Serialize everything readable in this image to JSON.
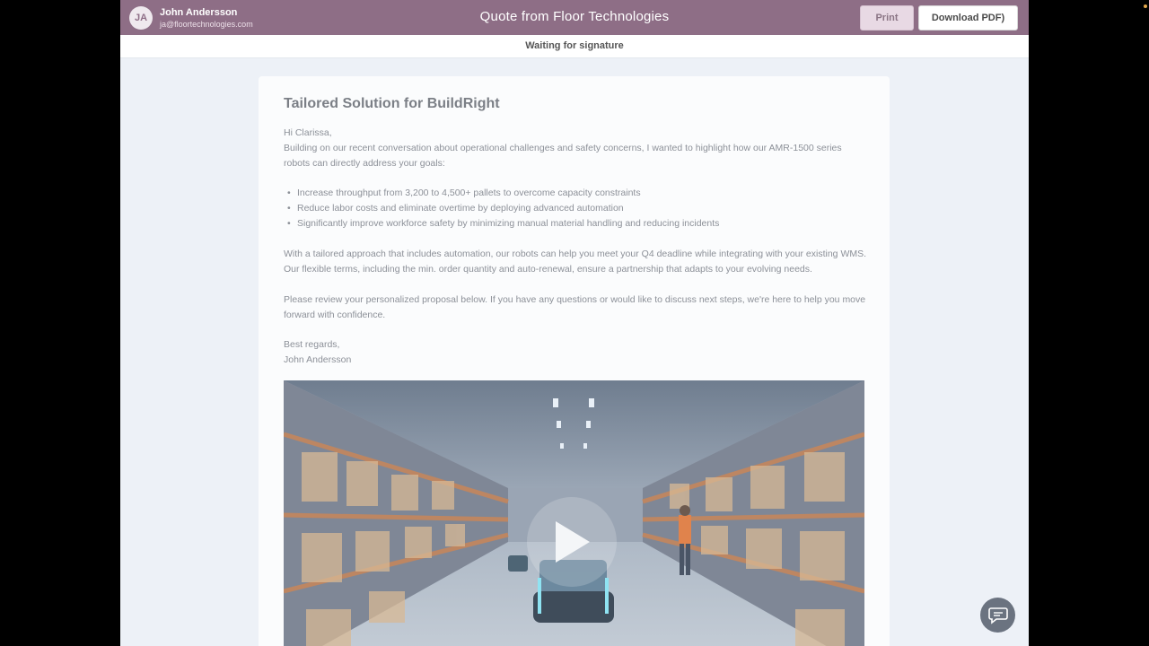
{
  "header": {
    "avatar_initials": "JA",
    "user_name": "John Andersson",
    "user_email": "ja@floortechnologies.com",
    "title": "Quote from Floor Technologies",
    "print_label": "Print",
    "download_label": "Download PDF)"
  },
  "status": {
    "text": "Waiting for signature"
  },
  "letter": {
    "title": "Tailored Solution for BuildRight",
    "greeting": "Hi Clarissa,",
    "intro": "Building on our recent conversation about operational challenges and safety concerns, I wanted to highlight how our AMR-1500 series robots can directly address your goals:",
    "bullets": [
      "Increase throughput from 3,200 to 4,500+ pallets to overcome capacity constraints",
      "Reduce labor costs and eliminate overtime by deploying advanced automation",
      "Significantly improve workforce safety by minimizing manual material handling and reducing incidents"
    ],
    "paragraph2": "With a tailored approach that includes automation, our robots can help you meet your Q4 deadline while integrating with your existing WMS. Our flexible terms, including the min. order quantity and auto-renewal, ensure a partnership that adapts to your evolving needs.",
    "paragraph3": "Please review your personalized proposal below. If you have any questions or would like to discuss next steps, we're here to help you move forward with confidence.",
    "signoff": "Best regards,",
    "signature": "John Andersson"
  },
  "media": {
    "play_icon": "play-icon",
    "chat_icon": "chat-icon"
  },
  "colors": {
    "header_bg": "#8e6e86",
    "page_bg": "#edf1f7",
    "card_bg": "#fbfcfd"
  }
}
